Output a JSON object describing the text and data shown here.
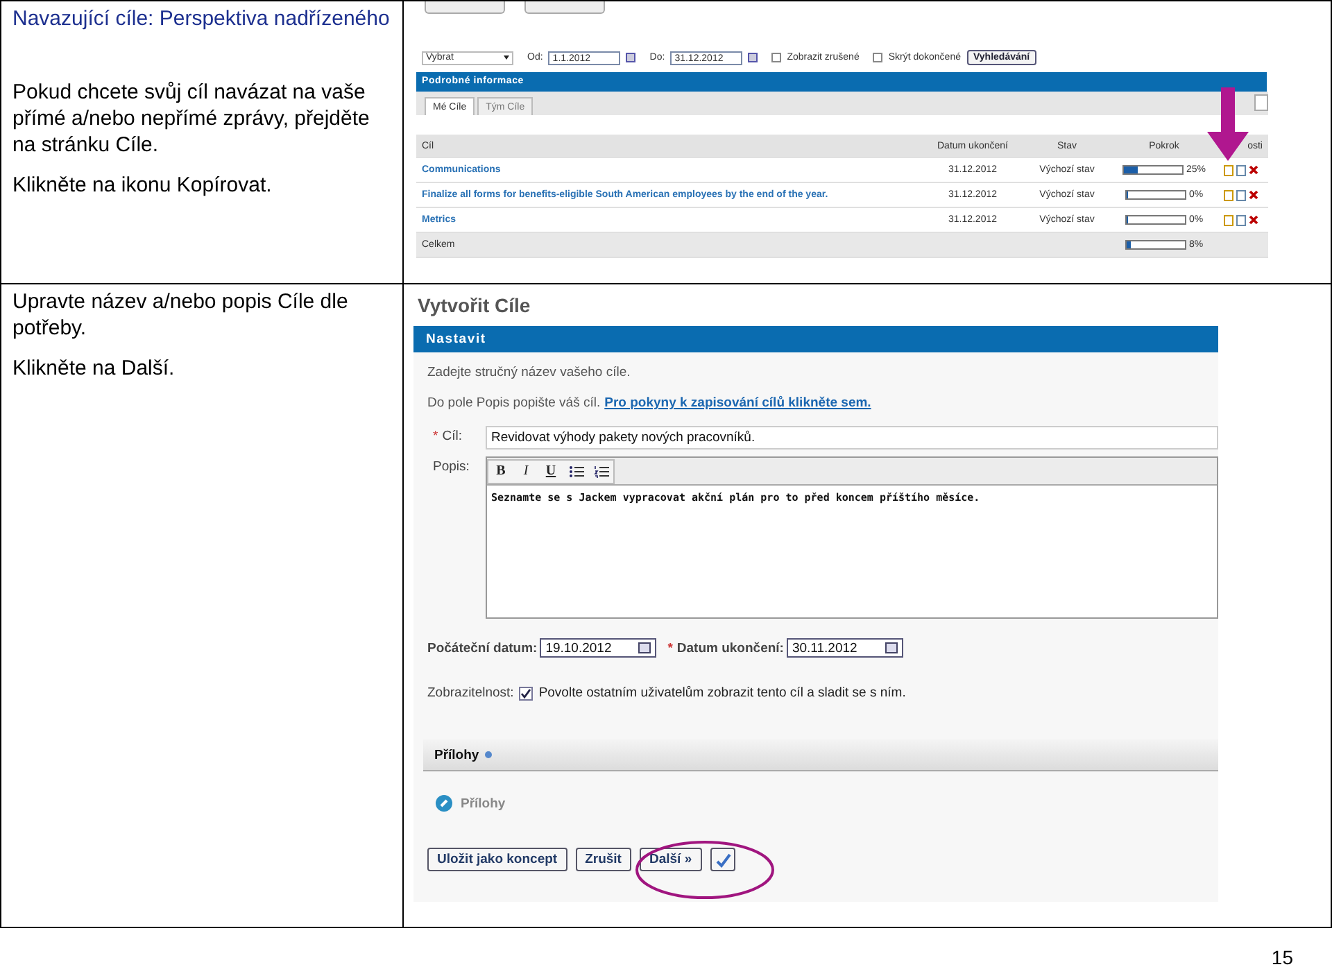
{
  "rows": [
    {
      "title": "Navazující cíle: Perspektiva nadřízeného",
      "paragraphs": [
        "Pokud chcete svůj cíl navázat na vaše přímé a/nebo nepřímé zprávy, přejděte na stránku Cíle.",
        "Klikněte na ikonu Kopírovat."
      ]
    },
    {
      "paragraphs": [
        "Upravte název a/nebo popis Cíle dle potřeby.",
        "Klikněte na Další."
      ]
    }
  ],
  "goals_screen": {
    "filter": {
      "select": "Vybrat",
      "from_label": "Od:",
      "from": "1.1.2012",
      "to_label": "Do:",
      "to": "31.12.2012",
      "checkboxes": [
        {
          "label": "Zobrazit zrušené",
          "checked": false
        },
        {
          "label": "Skrýt dokončené",
          "checked": false
        }
      ],
      "search_button": "Vyhledávání"
    },
    "panel_title": "Podrobné informace",
    "tabs": [
      {
        "label": "Mé Cíle",
        "selected": true
      },
      {
        "label": "Tým Cíle",
        "selected": false
      }
    ],
    "columns": [
      "Cíl",
      "Datum ukončení",
      "Stav",
      "Pokrok",
      "osti"
    ],
    "rows": [
      {
        "goal": "Communications",
        "date": "31.12.2012",
        "status": "Výchozí stav",
        "level": 0.25,
        "reading": "25%"
      },
      {
        "goal": "Finalize all forms for benefits-eligible South American employees by the end of the year.",
        "date": "31.12.2012",
        "status": "Výchozí stav",
        "level": 0,
        "reading": "0%"
      },
      {
        "goal": "Metrics",
        "date": "31.12.2012",
        "status": "Výchozí stav",
        "level": 0,
        "reading": "0%"
      }
    ],
    "total": {
      "label": "Celkem",
      "level": 0.08,
      "reading": "8%"
    }
  },
  "create_screen": {
    "title": "Vytvořit Cíle",
    "panel_title": "Nastavit",
    "hint": "Zadejte stručný název vašeho cíle.",
    "hint2": "Do pole Popis popište váš cíl.",
    "link": "Pro pokyny k zapisování cílů klikněte sem.",
    "goal": {
      "mark": "*",
      "label": "Cíl:",
      "value": "Revidovat výhody pakety nových pracovníků."
    },
    "description": {
      "label": "Popis:",
      "toolbar": [
        {
          "kind": "bold",
          "label": "B"
        },
        {
          "kind": "italic",
          "label": "I"
        },
        {
          "kind": "underline",
          "label": "U"
        },
        {
          "kind": "bullets"
        },
        {
          "kind": "numbers"
        }
      ],
      "value": "Seznamte se s Jackem vypracovat akční plán pro to před koncem příštího měsíce."
    },
    "start": {
      "label": "Počáteční datum:",
      "value": "19.10.2012"
    },
    "end": {
      "mark": "*",
      "label": "Datum ukončení:",
      "value": "30.11.2012"
    },
    "visibility": {
      "label": "Zobrazitelnost:",
      "checked": true,
      "text": "Povolte ostatním uživatelům zobrazit tento cíl a sladit se s ním."
    },
    "attachments_title": "Přílohy",
    "attachment": "Přílohy",
    "buttons": [
      "Uložit jako koncept",
      "Zrušit",
      "Další »"
    ]
  },
  "page_number": "15"
}
